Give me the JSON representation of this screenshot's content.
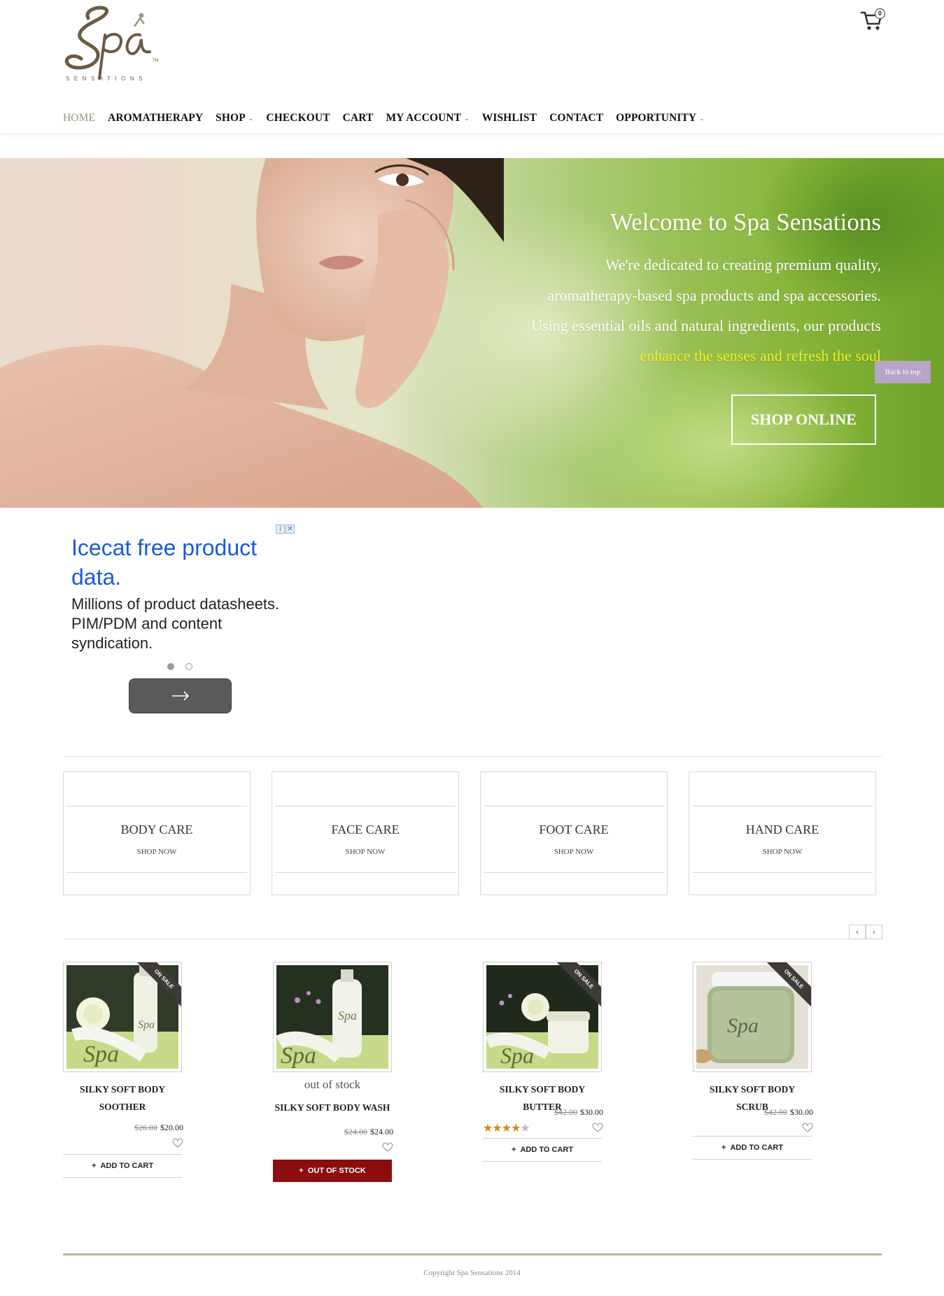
{
  "header": {
    "logo_text": "Spa",
    "logo_tagline": "SENSATIONS",
    "logo_tm": "TM",
    "cart_count": "0"
  },
  "nav": [
    {
      "label": "HOME",
      "active": true,
      "dropdown": false
    },
    {
      "label": "AROMATHERAPY",
      "active": false,
      "dropdown": false
    },
    {
      "label": "SHOP",
      "active": false,
      "dropdown": true
    },
    {
      "label": "CHECKOUT",
      "active": false,
      "dropdown": false
    },
    {
      "label": "CART",
      "active": false,
      "dropdown": false
    },
    {
      "label": "MY ACCOUNT",
      "active": false,
      "dropdown": true
    },
    {
      "label": "WISHLIST",
      "active": false,
      "dropdown": false
    },
    {
      "label": "CONTACT",
      "active": false,
      "dropdown": false
    },
    {
      "label": "OPPORTUNITY",
      "active": false,
      "dropdown": true
    }
  ],
  "hero": {
    "title": "Welcome to Spa Sensations",
    "line1": "We're dedicated to creating premium quality,",
    "line2": "aromatherapy-based spa products and spa accessories.",
    "line3": "Using essential oils and natural ingredients, our products",
    "line4": "enhance the senses and refresh the soul",
    "button": "SHOP ONLINE"
  },
  "back_to_top": "Back to top",
  "ad": {
    "headline": "Icecat free product data.",
    "description": "Millions of product datasheets. PIM/PDM and content syndication.",
    "badge_info": "i",
    "badge_close": "✕",
    "next_icon": "arrow-right-icon"
  },
  "categories": [
    {
      "title": "BODY CARE",
      "link": "SHOP NOW"
    },
    {
      "title": "FACE CARE",
      "link": "SHOP NOW"
    },
    {
      "title": "FOOT CARE",
      "link": "SHOP NOW"
    },
    {
      "title": "HAND CARE",
      "link": "SHOP NOW"
    }
  ],
  "carousel": {
    "prev": "‹",
    "next": "›"
  },
  "products": [
    {
      "name": "SILKY SOFT BODY SOOTHER",
      "old_price": "$26.00",
      "price": "$20.00",
      "ribbon": "ON SALE",
      "stock": "",
      "button": "ADD TO CART",
      "rating": null
    },
    {
      "name": "SILKY SOFT BODY WASH",
      "old_price": "$24.00",
      "price": "$24.00",
      "ribbon": "",
      "stock": "out of stock",
      "button": "OUT OF STOCK",
      "rating": null
    },
    {
      "name": "SILKY SOFT BODY BUTTER",
      "old_price": "$42.00",
      "price": "$30.00",
      "ribbon": "ON SALE",
      "stock": "",
      "button": "ADD TO CART",
      "rating": 4
    },
    {
      "name": "SILKY SOFT BODY SCRUB",
      "old_price": "$42.00",
      "price": "$30.00",
      "ribbon": "ON SALE",
      "stock": "",
      "button": "ADD TO CART",
      "rating": null
    }
  ],
  "footer": {
    "copyright": "Copyright Spa Sensations 2014"
  },
  "colors": {
    "nav_active": "#8e9a7c",
    "ad_headline": "#1a5bd8",
    "out_of_stock": "#8b0d0d",
    "stars": "#d4861c",
    "hero_highlight": "#f0f020",
    "back_to_top": "#b7a4c8"
  }
}
